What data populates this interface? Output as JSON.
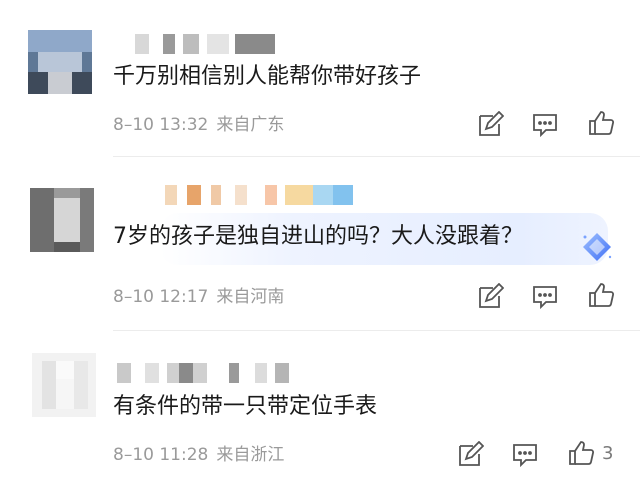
{
  "comments": [
    {
      "text": "千万别相信别人能帮你带好孩子",
      "time": "8–10 13:32",
      "location": "来自广东",
      "like_count": "",
      "icons": [
        "edit-icon",
        "comment-icon",
        "like-icon"
      ]
    },
    {
      "text": "7岁的孩子是独自进山的吗？大人没跟着？",
      "time": "8–10 12:17",
      "location": "来自河南",
      "like_count": "",
      "icons": [
        "edit-icon",
        "comment-icon",
        "like-icon",
        "diamond-badge-icon"
      ]
    },
    {
      "text": "有条件的带一只带定位手表",
      "time": "8–10 11:28",
      "location": "来自浙江",
      "like_count": "3",
      "icons": [
        "edit-icon",
        "comment-icon",
        "like-icon"
      ]
    }
  ],
  "colors": {
    "meta_text": "#9a9a9a",
    "icon_stroke": "#555555",
    "highlight": "#e6eeff",
    "badge_blue": "#4d7dff"
  }
}
